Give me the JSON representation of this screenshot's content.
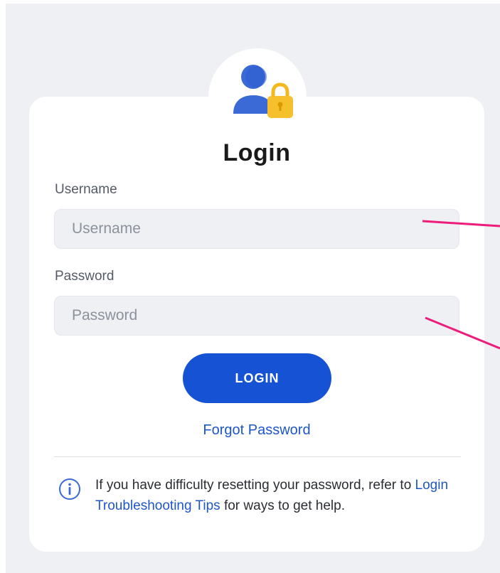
{
  "form": {
    "title": "Login",
    "username_label": "Username",
    "username_placeholder": "Username",
    "username_value": "",
    "password_label": "Password",
    "password_placeholder": "Password",
    "password_value": "",
    "login_button": "LOGIN",
    "forgot_password": "Forgot Password"
  },
  "help": {
    "text_before": "If you have difficulty resetting your password, refer to ",
    "link_text": "Login Troubleshooting Tips",
    "text_after": " for ways to get help."
  },
  "icons": {
    "avatar": "user-lock-icon",
    "info": "info-icon"
  },
  "colors": {
    "primary": "#1652d4",
    "link": "#1e56c8",
    "annotation": "#ee1c7a",
    "lock": "#f5c02c"
  }
}
